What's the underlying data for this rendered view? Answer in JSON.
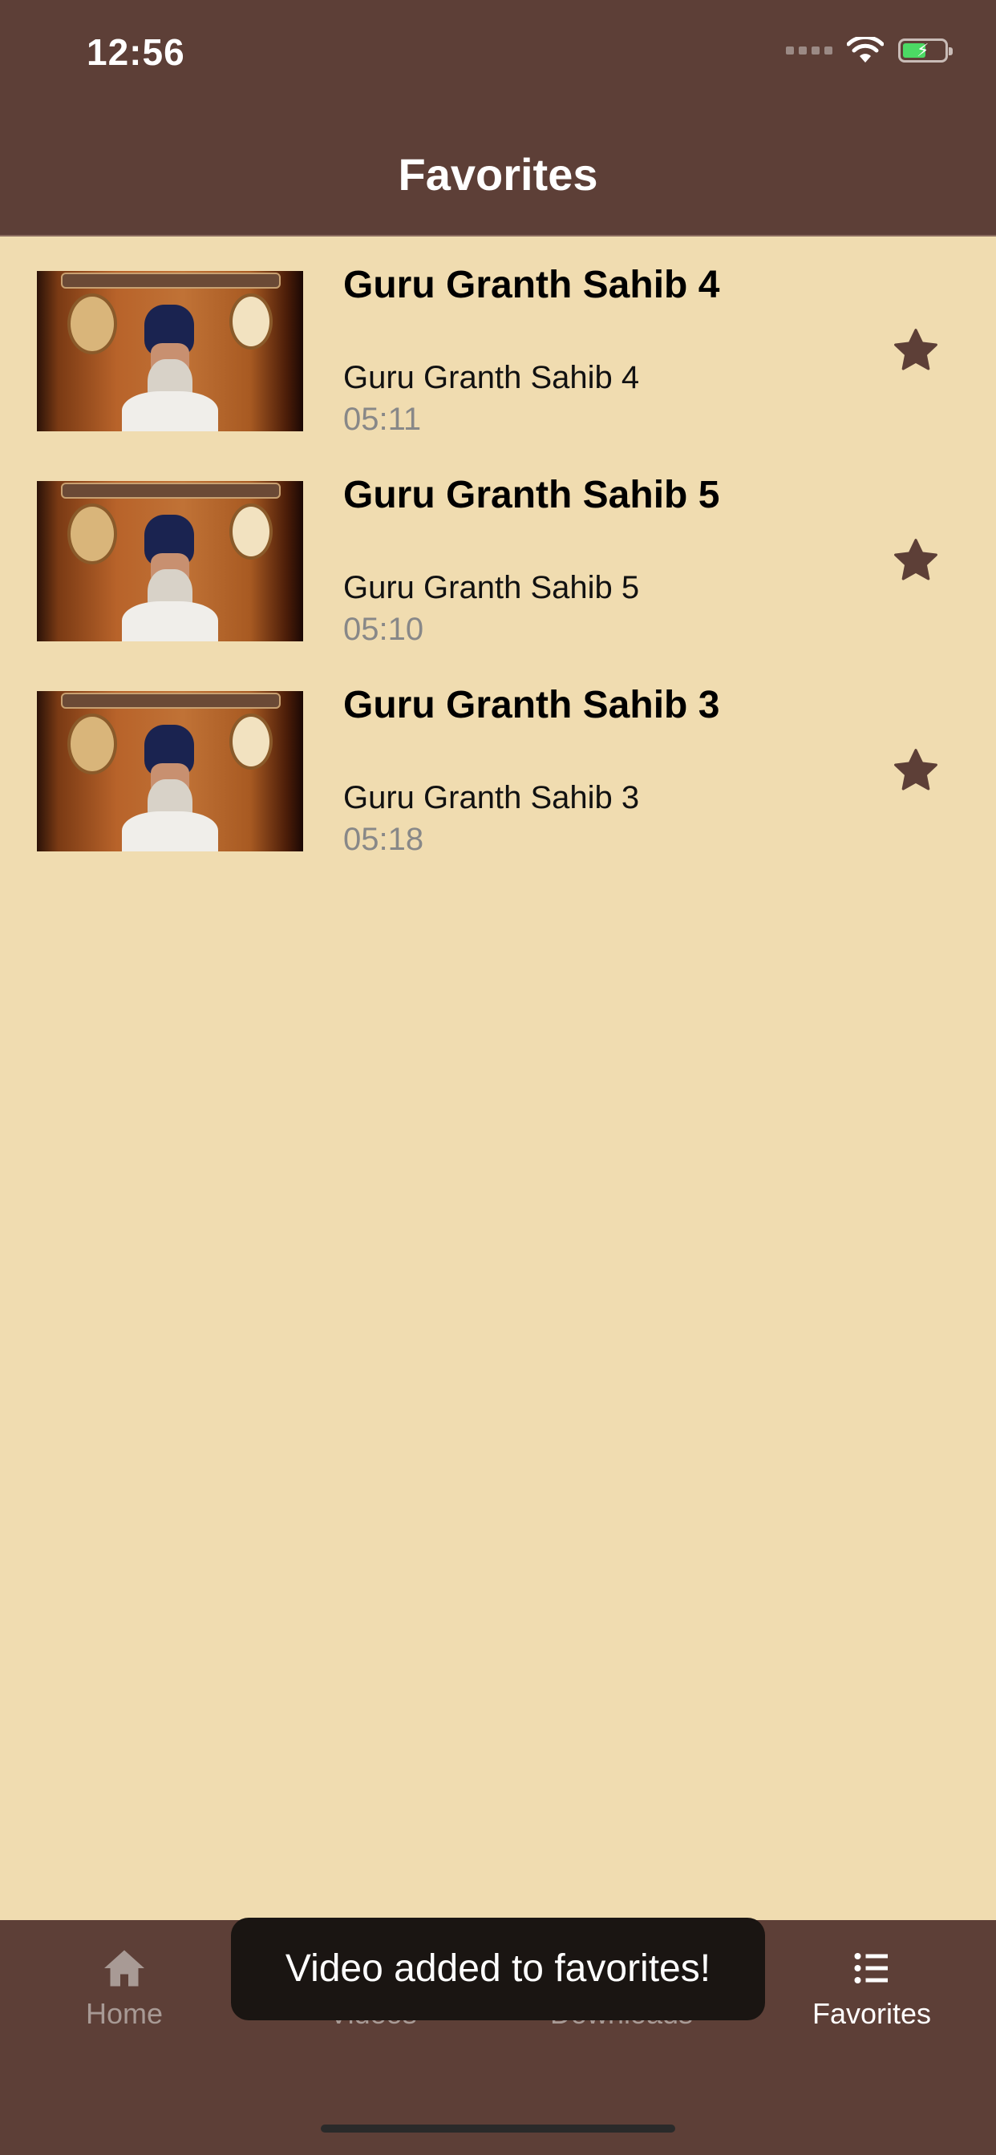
{
  "status_bar": {
    "time": "12:56"
  },
  "header": {
    "title": "Favorites"
  },
  "favorites": [
    {
      "title": "Guru Granth Sahib 4",
      "subtitle": "Guru Granth Sahib 4",
      "duration": "05:11"
    },
    {
      "title": "Guru Granth Sahib 5",
      "subtitle": "Guru Granth Sahib 5",
      "duration": "05:10"
    },
    {
      "title": "Guru Granth Sahib 3",
      "subtitle": "Guru Granth Sahib 3",
      "duration": "05:18"
    }
  ],
  "tabs": [
    {
      "label": "Home",
      "icon": "home-icon"
    },
    {
      "label": "Videos",
      "icon": "videos-icon"
    },
    {
      "label": "Downloads",
      "icon": "download-icon"
    },
    {
      "label": "Favorites",
      "icon": "list-icon",
      "active": true
    }
  ],
  "toast": {
    "message": "Video added to favorites!"
  },
  "colors": {
    "bar": "#5d3f37",
    "background": "#f0dcb0",
    "star": "#5d3f37",
    "tab_inactive": "#a89a95",
    "tab_active": "#ffffff"
  }
}
